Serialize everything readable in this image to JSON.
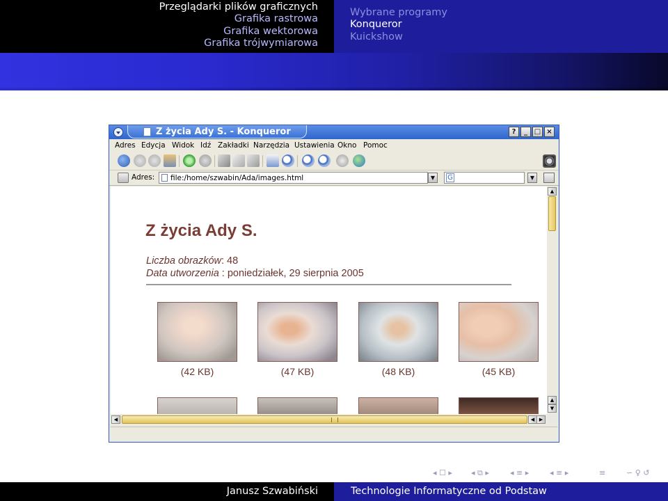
{
  "slide": {
    "nav_sections": {
      "current": "Przeglądarki plików graficznych",
      "others": [
        "Grafika rastrowa",
        "Grafika wektorowa",
        "Grafika trójwymiarowa"
      ]
    },
    "nav_subsections": {
      "items": [
        "Wybrane programy",
        "Konqueror",
        "Kuickshow"
      ],
      "active_index": 1
    },
    "footer": {
      "author": "Janusz Szwabiński",
      "title": "Technologie Informatyczne od Podstaw"
    },
    "nav_symbols": {
      "frame": "◂ ☐ ▸",
      "subsection": "◂ ⧉ ▸",
      "section": "◂ ≡ ▸",
      "part": "◂ ≡ ▸",
      "align": "≡",
      "search": "∽ ♀ ↺"
    }
  },
  "window": {
    "title": "Z życia Ady S. - Konqueror",
    "title_buttons": [
      "?",
      "_",
      "□",
      "×"
    ],
    "menu": [
      "Adres",
      "Edycja",
      "Widok",
      "Idź",
      "Zakładki",
      "Narzędzia",
      "Ustawienia",
      "Okno",
      "Pomoc"
    ],
    "location_label": "Adres:",
    "location_value": "file:/home/szwabin/Ada/images.html",
    "search_value": "",
    "colors": {
      "titlebar": "#2f66cc",
      "heading": "#7a3d35",
      "scroll_thumb": "#e7c85e"
    }
  },
  "page": {
    "heading": "Z życia Ady S.",
    "count_label": "Liczba obrazków",
    "count_value": ": 48",
    "date_label": "Data utworzenia",
    "date_value": " : poniedziałek, 29 sierpnia 2005",
    "thumbnails": [
      {
        "size": "(42 KB)"
      },
      {
        "size": "(47 KB)"
      },
      {
        "size": "(48 KB)"
      },
      {
        "size": "(45 KB)"
      }
    ]
  }
}
